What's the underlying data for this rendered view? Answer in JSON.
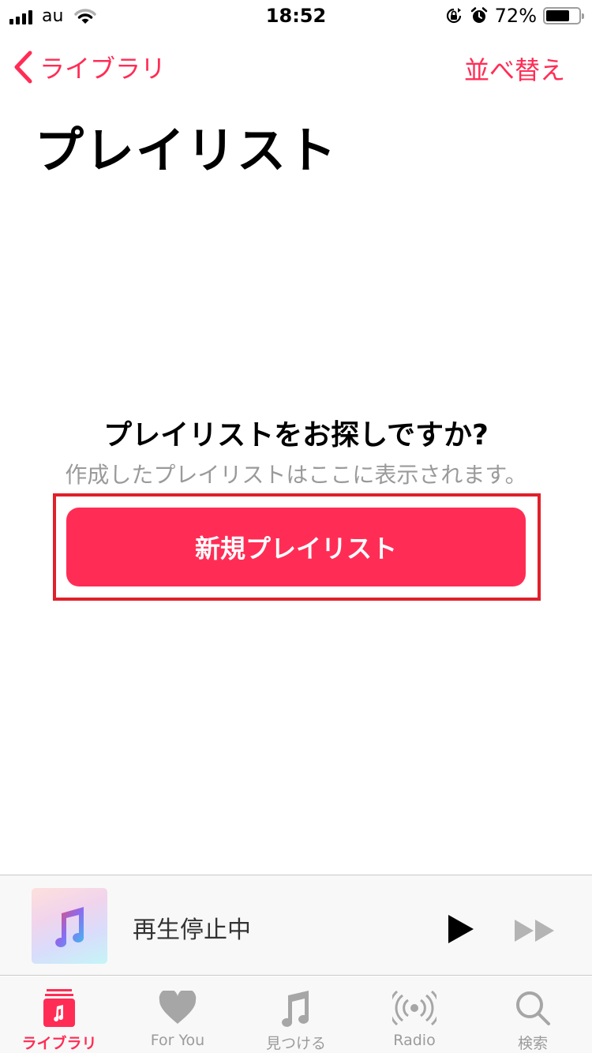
{
  "status_bar": {
    "carrier": "au",
    "time": "18:52",
    "battery_percent_label": "72%",
    "battery_level": 0.72,
    "icons": [
      "signal-icon",
      "wifi-icon",
      "orientation-lock-icon",
      "alarm-icon",
      "battery-icon"
    ]
  },
  "nav": {
    "back_label": "ライブラリ",
    "sort_label": "並べ替え"
  },
  "page": {
    "title": "プレイリスト"
  },
  "empty_state": {
    "title": "プレイリストをお探しですか?",
    "subtitle": "作成したプレイリストはここに表示されます。",
    "new_playlist_button": "新規プレイリスト"
  },
  "mini_player": {
    "title": "再生停止中",
    "play_icon": "play-icon",
    "forward_icon": "fast-forward-icon"
  },
  "tab_bar": {
    "items": [
      {
        "label": "ライブラリ",
        "icon": "library-icon",
        "active": true
      },
      {
        "label": "For You",
        "icon": "heart-icon",
        "active": false
      },
      {
        "label": "見つける",
        "icon": "music-note-icon",
        "active": false
      },
      {
        "label": "Radio",
        "icon": "radio-icon",
        "active": false
      },
      {
        "label": "検索",
        "icon": "search-icon",
        "active": false
      }
    ]
  },
  "colors": {
    "accent": "#ff2d55",
    "highlight_border": "#e0202a",
    "subtitle_gray": "#9a9a9a",
    "tab_inactive": "#9b9b9b"
  }
}
